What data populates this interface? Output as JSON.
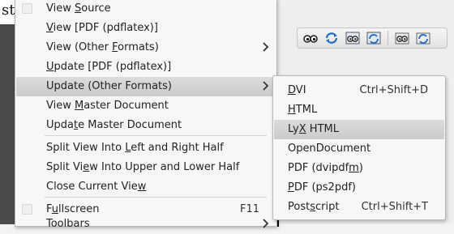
{
  "background": {
    "doc_glyph": "st"
  },
  "toolbar": {
    "buttons": [
      {
        "icon": "view-icon"
      },
      {
        "icon": "update-icon"
      },
      {
        "icon": "view-master-icon"
      },
      {
        "icon": "update-master-icon"
      },
      {
        "icon": "view-other-icon"
      },
      {
        "icon": "update-other-icon"
      }
    ]
  },
  "menu": {
    "items": [
      {
        "pre": "View ",
        "u": "S",
        "post": "ource",
        "accel": "",
        "submenu": false,
        "checkbox": true
      },
      {
        "pre": "",
        "u": "V",
        "post": "iew [PDF (pdflatex)]",
        "accel": "",
        "submenu": false,
        "checkbox": false
      },
      {
        "pre": "View (Other ",
        "u": "F",
        "post": "ormats)",
        "accel": "",
        "submenu": true,
        "checkbox": false
      },
      {
        "pre": "",
        "u": "U",
        "post": "pdate [PDF (pdflatex)]",
        "accel": "",
        "submenu": false,
        "checkbox": false
      },
      {
        "pre": "Update (Other Formats)",
        "u": "",
        "post": "",
        "accel": "",
        "submenu": true,
        "checkbox": false,
        "highlighted": true
      },
      {
        "pre": "View ",
        "u": "M",
        "post": "aster Document",
        "accel": "",
        "submenu": false,
        "checkbox": false
      },
      {
        "pre": "Upda",
        "u": "t",
        "post": "e Master Document",
        "accel": "",
        "submenu": false,
        "checkbox": false
      },
      {
        "pre": "Split View Into ",
        "u": "L",
        "post": "eft and Right Half",
        "accel": "",
        "submenu": false,
        "checkbox": false
      },
      {
        "pre": "Split Vi",
        "u": "e",
        "post": "w Into Upper and Lower Half",
        "accel": "",
        "submenu": false,
        "checkbox": false
      },
      {
        "pre": "Close Current Vie",
        "u": "w",
        "post": "",
        "accel": "",
        "submenu": false,
        "checkbox": false
      },
      {
        "pre": "F",
        "u": "u",
        "post": "llscreen",
        "accel": "F11",
        "submenu": false,
        "checkbox": true
      },
      {
        "pre": "Toolbars",
        "u": "",
        "post": "",
        "accel": "",
        "submenu": true,
        "checkbox": false
      }
    ]
  },
  "submenu": {
    "items": [
      {
        "pre": "",
        "u": "D",
        "post": "VI",
        "accel": "Ctrl+Shift+D"
      },
      {
        "pre": "",
        "u": "H",
        "post": "TML",
        "accel": ""
      },
      {
        "pre": "Ly",
        "u": "X",
        "post": " HTML",
        "accel": "",
        "highlighted": true
      },
      {
        "pre": "OpenDocument",
        "u": "",
        "post": "",
        "accel": ""
      },
      {
        "pre": "PDF (dvipdf",
        "u": "m",
        "post": ")",
        "accel": ""
      },
      {
        "pre": "",
        "u": "P",
        "post": "DF (ps2pdf)",
        "accel": ""
      },
      {
        "pre": "Post",
        "u": "s",
        "post": "cript",
        "accel": "Ctrl+Shift+T"
      }
    ]
  }
}
